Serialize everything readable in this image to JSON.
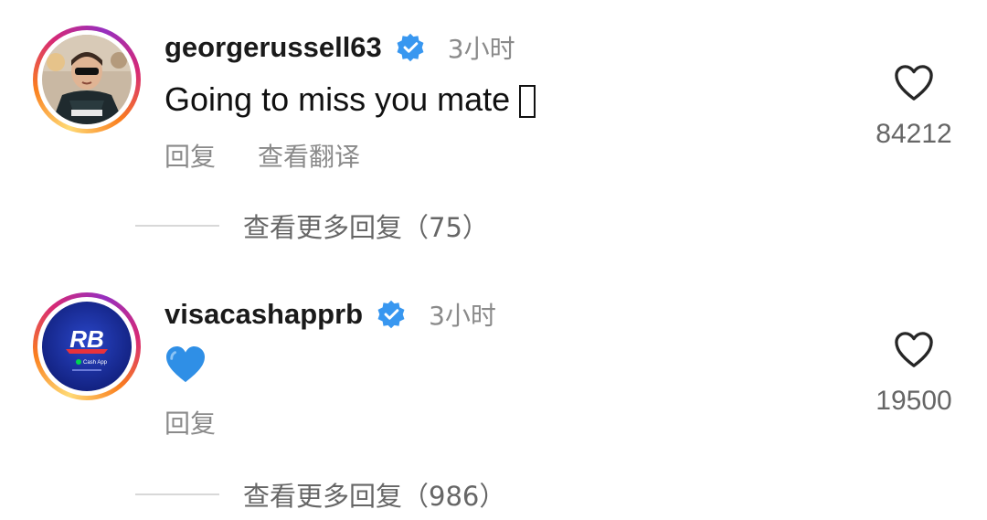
{
  "comments": [
    {
      "username": "georgerussell63",
      "time": "3小时",
      "text": "Going to miss you mate",
      "actions": [
        "回复",
        "查看翻译"
      ],
      "likes": "84212",
      "more_replies": "查看更多回复（75）"
    },
    {
      "username": "visacashapprb",
      "time": "3小时",
      "text": "💙",
      "actions": [
        "回复"
      ],
      "likes": "19500",
      "more_replies": "查看更多回复（986）"
    }
  ],
  "colors": {
    "verified": "#3897f0",
    "secondary_text": "#8a8a8a",
    "heart_outline": "#262626"
  }
}
